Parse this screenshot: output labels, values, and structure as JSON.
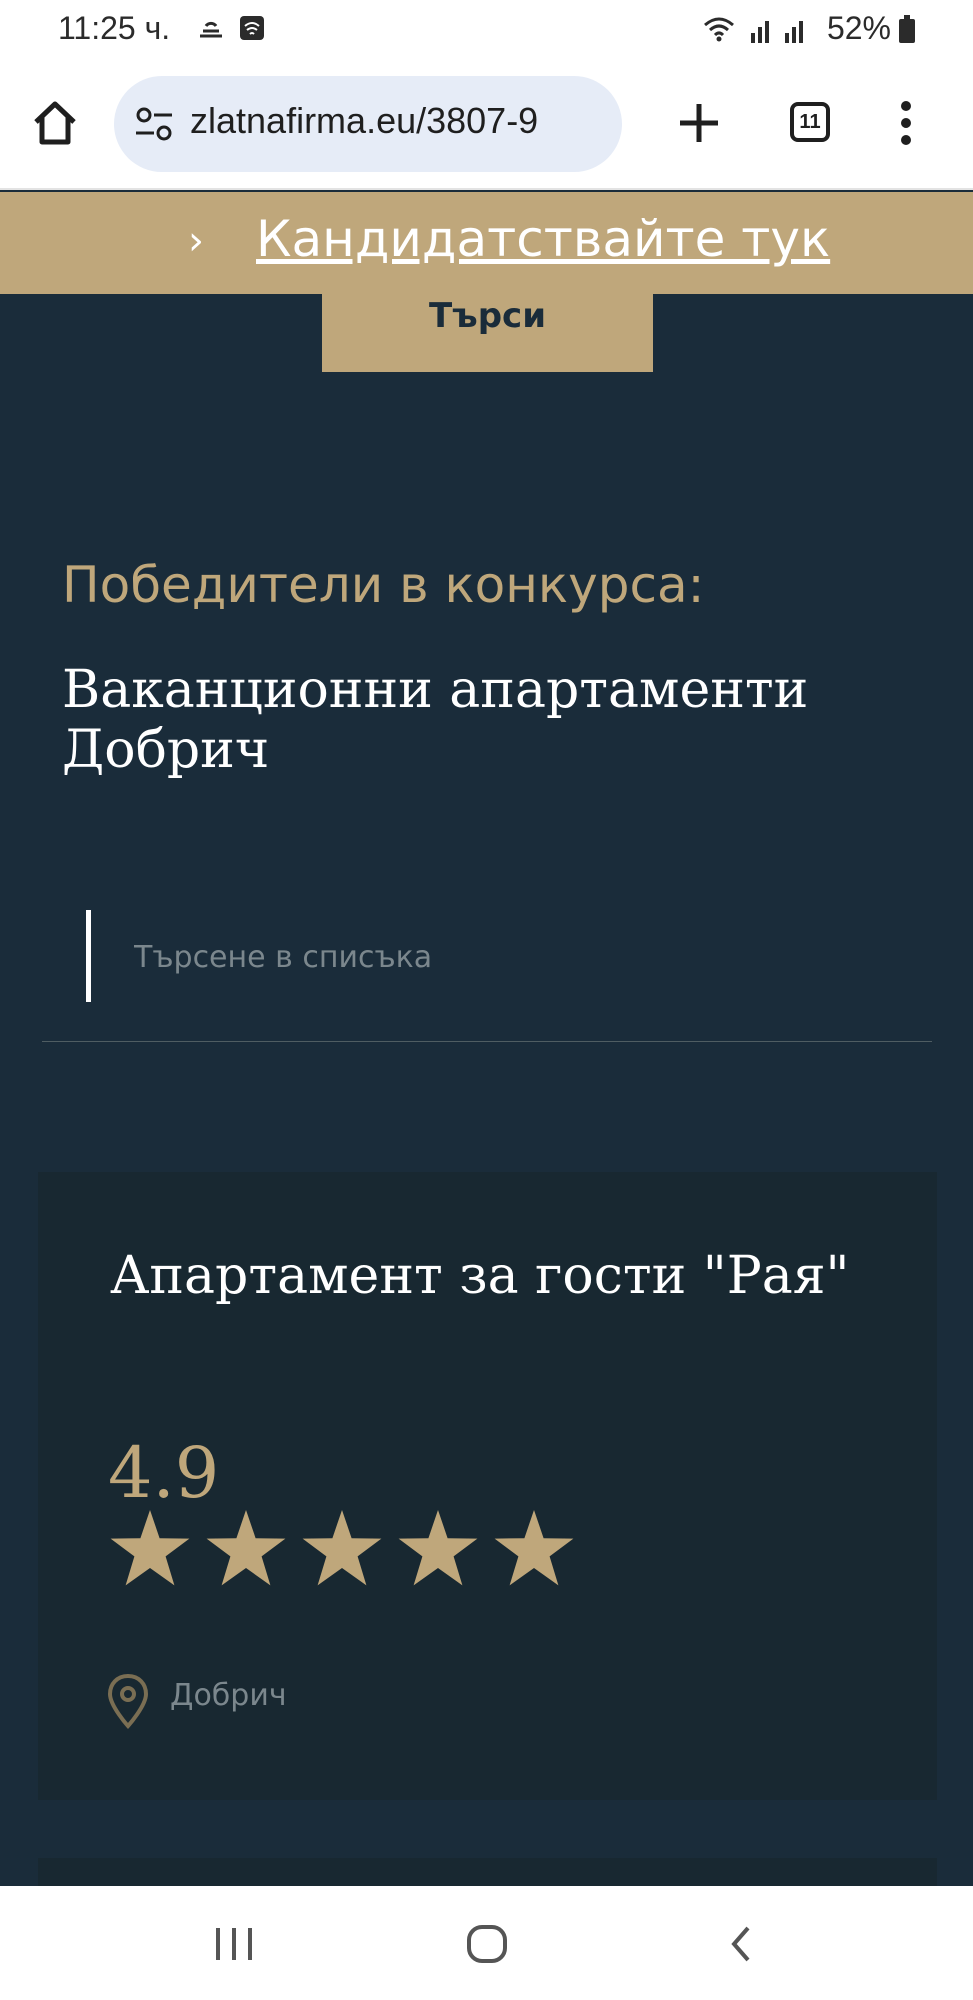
{
  "status_bar": {
    "time": "11:25 ч.",
    "battery": "52%"
  },
  "browser": {
    "url": "zlatnafirma.eu/3807-9",
    "tab_count": "11"
  },
  "banner": {
    "chevron": "›",
    "link_text": "Кандидатствайте тук"
  },
  "search_button_label": "Търси",
  "winners_label": "Победители в конкурса:",
  "category_title": "Ваканционни апартаменти Добрич",
  "list_search": {
    "placeholder": "Търсене в списъка"
  },
  "listings": [
    {
      "name": "Апартамент за гости \"Рая\"",
      "rating": "4.9",
      "stars": 5,
      "city": "Добрич"
    }
  ],
  "colors": {
    "background": "#1a2c3a",
    "card": "#182831",
    "accent_gold": "#bfa77b",
    "muted_text": "#7b878d"
  },
  "icons": {
    "home": "home-icon",
    "site_settings": "tune-icon",
    "new_tab": "plus-icon",
    "menu": "more-vertical-icon",
    "location": "location-pin-icon",
    "star": "star-icon"
  }
}
